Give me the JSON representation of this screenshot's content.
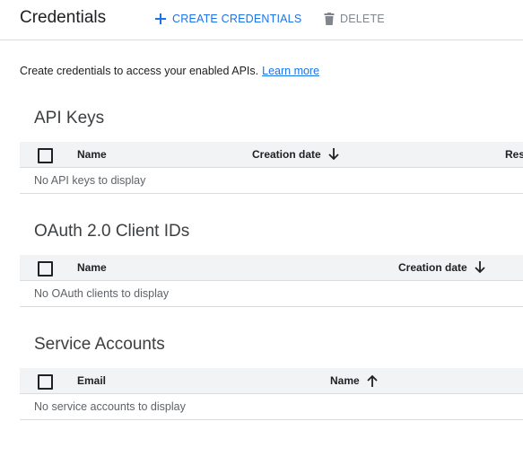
{
  "header": {
    "title": "Credentials",
    "create_label": "CREATE CREDENTIALS",
    "delete_label": "DELETE"
  },
  "intro": {
    "text": "Create credentials to access your enabled APIs.",
    "link": "Learn more"
  },
  "api_keys": {
    "title": "API Keys",
    "columns": [
      "Name",
      "Creation date",
      "Res"
    ],
    "empty": "No API keys to display"
  },
  "oauth": {
    "title": "OAuth 2.0 Client IDs",
    "columns": [
      "Name",
      "Creation date"
    ],
    "empty": "No OAuth clients to display"
  },
  "service_accounts": {
    "title": "Service Accounts",
    "columns": [
      "Email",
      "Name"
    ],
    "empty": "No service accounts to display"
  },
  "icons": {
    "create": "plus-icon",
    "delete": "trash-icon",
    "sort_desc": "arrow-down-icon",
    "sort_asc": "arrow-up-icon"
  },
  "colors": {
    "accent": "#1a73e8",
    "header_bg": "#f1f3f4",
    "divider": "#dadce0",
    "muted": "#5f6368"
  }
}
